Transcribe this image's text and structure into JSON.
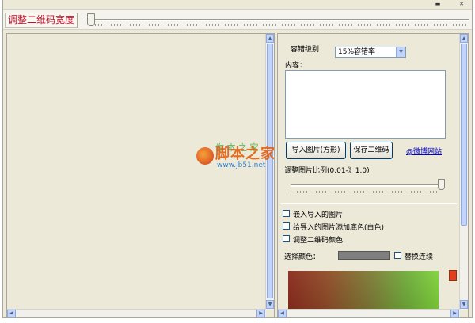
{
  "window": {
    "title_label": "调整二维码宽度",
    "sys_buttons": [
      "▬",
      "✕"
    ]
  },
  "width_slider": {
    "value": 0.0
  },
  "settings": {
    "error_level_label": "容错级别",
    "error_level_selected": "15%容错率",
    "content_label": "内容：",
    "content_value": "",
    "import_button": "导入图片(方形)",
    "save_button": "保存二维码",
    "link_text": "@微博网站",
    "ratio_label": "调整图片比例(0.01-》1.0)",
    "ratio_slider": {
      "value": 1.0
    },
    "checkboxes": [
      {
        "label": "嵌入导入的图片",
        "checked": false
      },
      {
        "label": "给导入的图片添加底色(白色)",
        "checked": false
      },
      {
        "label": "调整二维码颜色",
        "checked": false
      }
    ],
    "select_color_label": "选择颜色：",
    "selected_color": "#7f7f7f",
    "replace_continuous_label": "替换连续",
    "replace_continuous_checked": false
  },
  "watermark": {
    "main_text": "脚本之家",
    "green_text": "你 本 之 家",
    "url_text": "www.jb51.net"
  },
  "colors": {
    "accent_red": "#c0102a",
    "panel_bg": "#ece9d8",
    "scroll_blue": "#c3d4fc"
  }
}
